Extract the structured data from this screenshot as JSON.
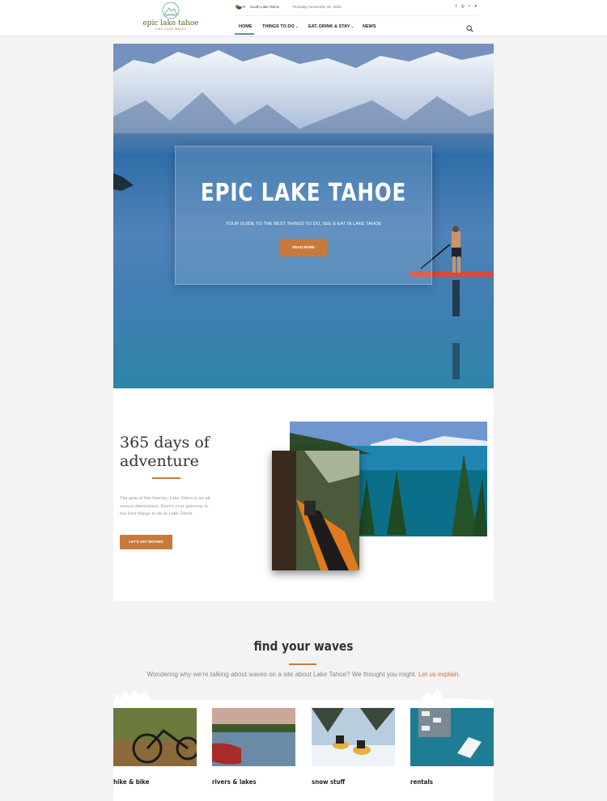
{
  "header": {
    "logo_name": "epic lake tahoe",
    "logo_tagline": "FIND YOUR WAVES",
    "weather_temp": "34",
    "location": "South Lake Tahoe",
    "date": "Thursday, November 26, 2020",
    "social_icons": [
      "facebook-icon",
      "instagram-icon",
      "pinterest-icon",
      "twitter-icon"
    ],
    "nav": [
      {
        "label": "HOME",
        "active": true
      },
      {
        "label": "THINGS TO DO",
        "dropdown": true
      },
      {
        "label": "EAT, DRINK & STAY",
        "dropdown": true
      },
      {
        "label": "NEWS"
      }
    ],
    "search_icon": "search-icon"
  },
  "hero": {
    "title": "EPIC LAKE TAHOE",
    "subtitle": "YOUR GUIDE TO THE BEST THINGS TO DO, SEE & EAT IN LAKE TAHOE",
    "button": "READ MORE"
  },
  "adventure": {
    "title_line1": "365 days of",
    "title_line2": "adventure",
    "text": "The gem of the Sierras, Lake Tahoe is an all-season destination. Here's your gateway to the best things to do in Lake Tahoe.",
    "button": "LET'S GET MOVING"
  },
  "waves": {
    "title": "find your waves",
    "text": "Wondering why we're talking about waves on a site about Lake Tahoe? We thought you might.",
    "link": "Let us explain.",
    "tiles": [
      {
        "label": "hike & bike"
      },
      {
        "label": "rivers & lakes"
      },
      {
        "label": "snow stuff"
      },
      {
        "label": "rentals"
      }
    ]
  },
  "colors": {
    "accent": "#c87a3d",
    "nav_underline": "#4f9a94",
    "logo_green": "#4f6a2a"
  }
}
